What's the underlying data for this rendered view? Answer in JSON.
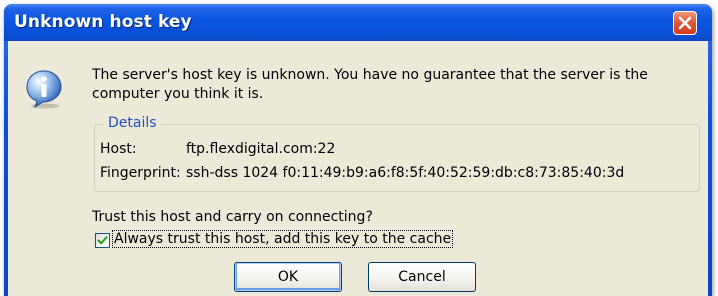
{
  "window": {
    "title": "Unknown host key"
  },
  "message": "The server's host key is unknown. You have no guarantee that the server is the computer you think it is.",
  "details": {
    "legend": "Details",
    "host_label": "Host:",
    "host_value": "ftp.flexdigital.com:22",
    "fingerprint_label": "Fingerprint:",
    "fingerprint_value": "ssh-dss 1024 f0:11:49:b9:a6:f8:5f:40:52:59:db:c8:73:85:40:3d"
  },
  "question": "Trust this host and carry on connecting?",
  "checkbox": {
    "label": "Always trust this host, add this key to the cache",
    "checked": true
  },
  "buttons": {
    "ok": "OK",
    "cancel": "Cancel"
  },
  "icons": {
    "dialog_icon": "info-icon",
    "close": "close-icon"
  },
  "colors": {
    "titlebar": "#0a55e0",
    "client": "#ece9d8",
    "legend": "#2150c4",
    "close": "#e2593a"
  }
}
